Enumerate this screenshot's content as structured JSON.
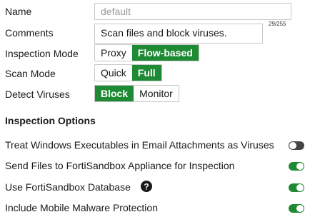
{
  "form": {
    "name_label": "Name",
    "name_placeholder": "default",
    "comments_label": "Comments",
    "comments_value": "Scan files and block viruses.",
    "comments_counter": "29/255",
    "inspection_mode_label": "Inspection Mode",
    "inspection_mode_options": [
      "Proxy",
      "Flow-based"
    ],
    "inspection_mode_selected": "Flow-based",
    "scan_mode_label": "Scan Mode",
    "scan_mode_options": [
      "Quick",
      "Full"
    ],
    "scan_mode_selected": "Full",
    "detect_viruses_label": "Detect Viruses",
    "detect_viruses_options": [
      "Block",
      "Monitor"
    ],
    "detect_viruses_selected": "Block"
  },
  "inspection_options": {
    "title": "Inspection Options",
    "items": [
      {
        "label": "Treat Windows Executables in Email Attachments as Viruses",
        "enabled": false
      },
      {
        "label": "Send Files to FortiSandbox Appliance for Inspection",
        "enabled": true
      },
      {
        "label": "Use FortiSandbox Database",
        "enabled": true,
        "help_icon": "question-circle-icon"
      },
      {
        "label": "Include Mobile Malware Protection",
        "enabled": true
      }
    ]
  },
  "colors": {
    "accent_green": "#1e8a34",
    "toggle_off": "#444444",
    "border": "#c8c8c8"
  }
}
